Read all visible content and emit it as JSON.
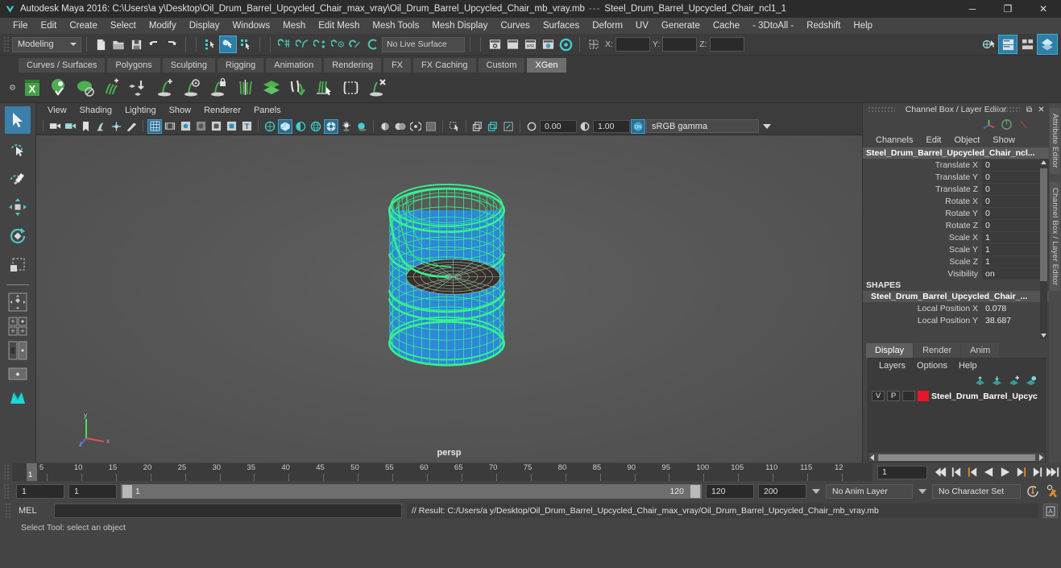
{
  "titlebar": {
    "app_title": "Autodesk Maya 2016: C:\\Users\\a y\\Desktop\\Oil_Drum_Barrel_Upcycled_Chair_max_vray\\Oil_Drum_Barrel_Upcycled_Chair_mb_vray.mb",
    "separator": "---",
    "selection": "Steel_Drum_Barrel_Upcycled_Chair_ncl1_1",
    "minimize": "─",
    "maximize": "❐",
    "close": "✕"
  },
  "menubar": {
    "items": [
      "File",
      "Edit",
      "Create",
      "Select",
      "Modify",
      "Display",
      "Windows",
      "Mesh",
      "Edit Mesh",
      "Mesh Tools",
      "Mesh Display",
      "Curves",
      "Surfaces",
      "Deform",
      "UV",
      "Generate",
      "Cache",
      "- 3DtoAll -",
      "Redshift",
      "Help"
    ]
  },
  "statusline": {
    "menuset": "Modeling",
    "live_surface": "No Live Surface",
    "coord_x_label": "X:",
    "coord_y_label": "Y:",
    "coord_z_label": "Z:",
    "coord_x": "",
    "coord_y": "",
    "coord_z": ""
  },
  "shelf": {
    "tabs": [
      "Curves / Surfaces",
      "Polygons",
      "Sculpting",
      "Rigging",
      "Animation",
      "Rendering",
      "FX",
      "FX Caching",
      "Custom",
      "XGen"
    ],
    "active_tab": "XGen",
    "icons": [
      "xgen-editor-icon",
      "xgen-preview-icon",
      "xgen-create-description-icon",
      "xgen-add-groom-icon",
      "xgen-place-icon",
      "xgen-add-guide-icon",
      "xgen-guide-display-icon",
      "xgen-lock-guide-icon",
      "xgen-part-icon",
      "xgen-layers-icon",
      "xgen-comb-icon",
      "xgen-select-guides-icon",
      "xgen-region-icon",
      "xgen-delete-guide-icon"
    ]
  },
  "toolbox": {
    "tools": [
      "select-tool",
      "lasso-select-tool",
      "paint-select-tool",
      "move-tool",
      "rotate-tool",
      "scale-tool"
    ],
    "selected": "select-tool",
    "layouts": [
      "single-perspective-layout",
      "four-view-layout",
      "two-pane-layout",
      "outliner-persp-layout",
      "persp-graph-layout",
      "hypershade-layout"
    ]
  },
  "viewport": {
    "menus": [
      "View",
      "Shading",
      "Lighting",
      "Show",
      "Renderer",
      "Panels"
    ],
    "exposure_value": "0.00",
    "gamma_value": "1.00",
    "color_management": "sRGB gamma",
    "camera_label": "persp",
    "axis_labels": {
      "x": "x",
      "y": "y",
      "z": "z"
    }
  },
  "channelbox": {
    "panel_title": "Channel Box / Layer Editor",
    "undock_icon": "⧉",
    "close_icon": "✕",
    "menus": [
      "Channels",
      "Edit",
      "Object",
      "Show"
    ],
    "node_name": "Steel_Drum_Barrel_Upcycled_Chair_ncl...",
    "transform_attrs": [
      {
        "label": "Translate X",
        "value": "0"
      },
      {
        "label": "Translate Y",
        "value": "0"
      },
      {
        "label": "Translate Z",
        "value": "0"
      },
      {
        "label": "Rotate X",
        "value": "0"
      },
      {
        "label": "Rotate Y",
        "value": "0"
      },
      {
        "label": "Rotate Z",
        "value": "0"
      },
      {
        "label": "Scale X",
        "value": "1"
      },
      {
        "label": "Scale Y",
        "value": "1"
      },
      {
        "label": "Scale Z",
        "value": "1"
      },
      {
        "label": "Visibility",
        "value": "on"
      }
    ],
    "shapes_header": "SHAPES",
    "shape_name": "Steel_Drum_Barrel_Upcycled_Chair_...",
    "shape_attrs": [
      {
        "label": "Local Position X",
        "value": "0.078"
      },
      {
        "label": "Local Position Y",
        "value": "38.687"
      }
    ]
  },
  "layereditor": {
    "tabs": [
      "Display",
      "Render",
      "Anim"
    ],
    "active_tab": "Display",
    "menus": [
      "Layers",
      "Options",
      "Help"
    ],
    "toolbar_icons": [
      "move-layer-up-icon",
      "move-layer-down-icon",
      "new-layer-icon",
      "new-layer-from-selected-icon"
    ],
    "layers": [
      {
        "visibility": "V",
        "playback": "P",
        "shading": "",
        "color": "#e8152b",
        "name": "Steel_Drum_Barrel_Upcyc"
      }
    ]
  },
  "sidetabs": [
    "Attribute Editor",
    "Channel Box / Layer Editor"
  ],
  "timeslider": {
    "tick_labels": [
      "5",
      "10",
      "15",
      "20",
      "25",
      "30",
      "35",
      "40",
      "45",
      "50",
      "55",
      "60",
      "65",
      "70",
      "75",
      "80",
      "85",
      "90",
      "95",
      "100",
      "105",
      "110",
      "115",
      "12"
    ],
    "current_frame": "1",
    "current_frame_field": "1",
    "playback_buttons": [
      "go-to-start-icon",
      "step-back-keyframe-icon",
      "step-back-frame-icon",
      "play-backwards-icon",
      "play-forwards-icon",
      "step-forward-frame-icon",
      "step-forward-keyframe-icon",
      "go-to-end-icon"
    ]
  },
  "rangeslider": {
    "anim_start": "1",
    "playback_start": "1",
    "range_start_label": "1",
    "range_end_label": "120",
    "playback_end": "120",
    "anim_end": "200",
    "anim_layer": "No Anim Layer",
    "character_set": "No Character Set",
    "auto_key_icon": "auto-keyframe-icon",
    "anim_prefs_icon": "animation-preferences-icon"
  },
  "commandline": {
    "mel_label": "MEL",
    "mel_input": "",
    "result": "// Result: C:/Users/a y/Desktop/Oil_Drum_Barrel_Upcycled_Chair_max_vray/Oil_Drum_Barrel_Upcycled_Chair_mb_vray.mb",
    "script_editor_icon": "script-editor-icon"
  },
  "statusbar": {
    "help_text": "Select Tool: select an object"
  },
  "colors": {
    "accent_blue": "#2d7fa8",
    "shelf_green": "#4caf50",
    "wireframe_green": "#3bff8f",
    "mesh_blue": "#2d8fe0",
    "layer_red": "#e8152b",
    "panel_bg": "#444444"
  }
}
